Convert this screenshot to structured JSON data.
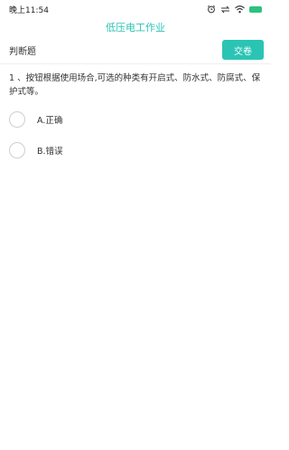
{
  "status_bar": {
    "time": "晚上11:54"
  },
  "app": {
    "title": "低压电工作业"
  },
  "toolbar": {
    "question_type": "判断题",
    "submit_label": "交卷"
  },
  "question": {
    "text": "1 、按钮根据使用场合,可选的种类有开启式、防水式、防腐式、保护式等。"
  },
  "options": [
    {
      "label": "A.正确"
    },
    {
      "label": "B.错误"
    }
  ],
  "colors": {
    "accent": "#2bc4b4",
    "battery": "#2ec27e"
  },
  "icons": [
    "alarm-icon",
    "data-icon",
    "wifi-icon",
    "battery-icon"
  ]
}
